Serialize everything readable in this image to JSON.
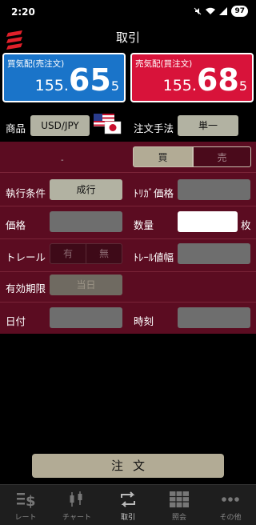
{
  "status": {
    "time": "2:20",
    "battery": "97"
  },
  "header": {
    "title": "取引"
  },
  "bid": {
    "label": "買気配(売注文)",
    "price_prefix": "155.",
    "price_big": "65",
    "price_pip": "5"
  },
  "ask": {
    "label": "売気配(買注文)",
    "price_prefix": "155.",
    "price_big": "68",
    "price_pip": "5"
  },
  "product": {
    "label": "商品",
    "value": "USD/JPY"
  },
  "method": {
    "label": "注文手法",
    "value": "単一"
  },
  "side": {
    "dash": "-",
    "buy": "買",
    "sell": "売"
  },
  "condition": {
    "label": "執行条件",
    "value": "成行"
  },
  "trigger_price": {
    "label": "ﾄﾘｶﾞ価格"
  },
  "price": {
    "label": "価格"
  },
  "quantity": {
    "label": "数量",
    "unit": "枚"
  },
  "trail": {
    "label": "トレール",
    "on": "有",
    "off": "無"
  },
  "trail_width": {
    "label": "ﾄﾚｰﾙ値幅"
  },
  "expiry": {
    "label": "有効期限",
    "value": "当日"
  },
  "date": {
    "label": "日付"
  },
  "time": {
    "label": "時刻"
  },
  "order_button": {
    "label": "注文"
  },
  "tabs": [
    {
      "label": "レート",
      "icon": "rate-icon"
    },
    {
      "label": "チャート",
      "icon": "chart-icon"
    },
    {
      "label": "取引",
      "icon": "trade-icon"
    },
    {
      "label": "照会",
      "icon": "inquiry-icon"
    },
    {
      "label": "その他",
      "icon": "more-icon"
    }
  ],
  "colors": {
    "bid": "#1a74c9",
    "ask": "#d8133a",
    "panel": "#5b0c21",
    "button": "#b2ab95"
  }
}
